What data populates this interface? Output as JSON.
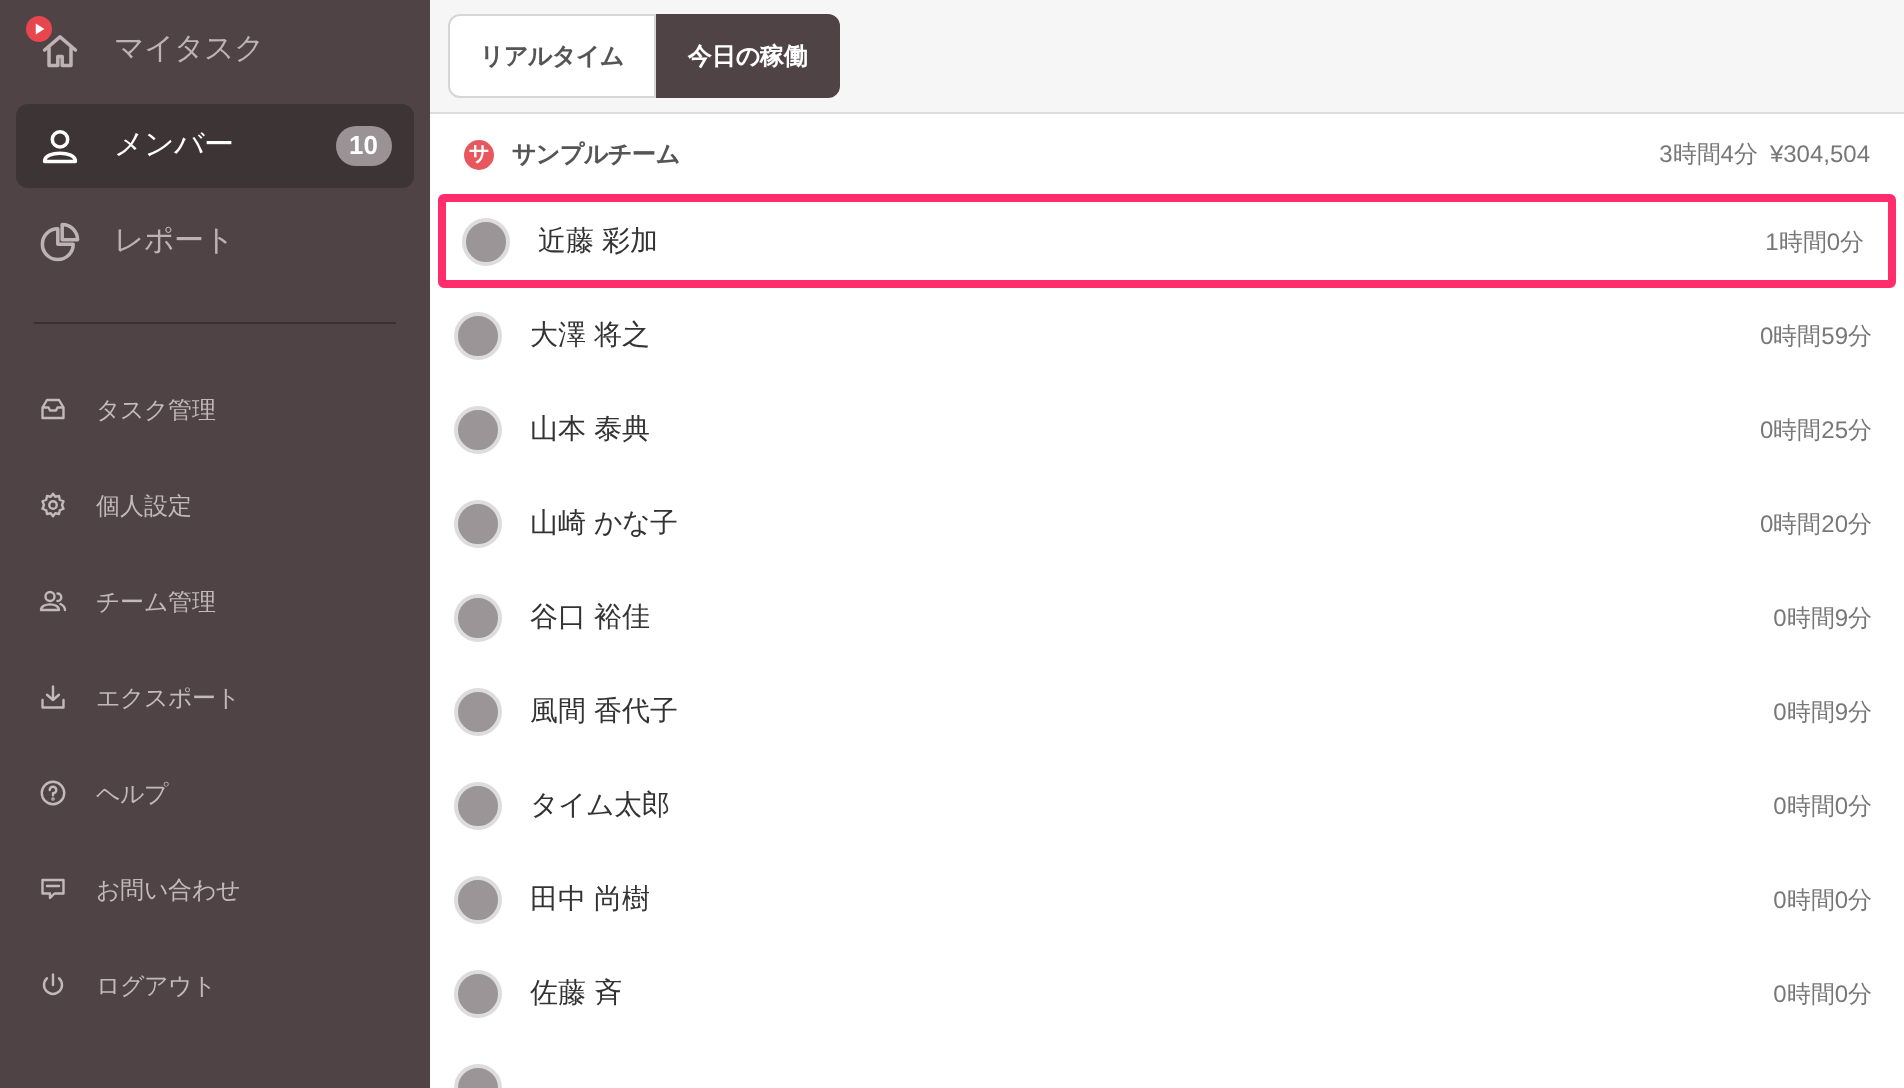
{
  "sidebar": {
    "main_items": [
      {
        "label": "マイタスク",
        "selected": false,
        "notification": true
      },
      {
        "label": "メンバー",
        "selected": true,
        "badge": "10",
        "notification": false
      },
      {
        "label": "レポート",
        "selected": false,
        "notification": false
      }
    ],
    "sub_items": [
      {
        "label": "タスク管理"
      },
      {
        "label": "個人設定"
      },
      {
        "label": "チーム管理"
      },
      {
        "label": "エクスポート"
      },
      {
        "label": "ヘルプ"
      },
      {
        "label": "お問い合わせ"
      },
      {
        "label": "ログアウト"
      }
    ]
  },
  "tabs": [
    {
      "label": "リアルタイム",
      "selected": false
    },
    {
      "label": "今日の稼働",
      "selected": true
    }
  ],
  "team": {
    "initial": "サ",
    "name": "サンプルチーム",
    "time": "3時間4分",
    "amount": "¥304,504"
  },
  "members": [
    {
      "name": "近藤 彩加",
      "time": "1時間0分",
      "highlighted": true
    },
    {
      "name": "大澤 将之",
      "time": "0時間59分",
      "highlighted": false
    },
    {
      "name": "山本 泰典",
      "time": "0時間25分",
      "highlighted": false
    },
    {
      "name": "山崎 かな子",
      "time": "0時間20分",
      "highlighted": false
    },
    {
      "name": "谷口 裕佳",
      "time": "0時間9分",
      "highlighted": false
    },
    {
      "name": "風間 香代子",
      "time": "0時間9分",
      "highlighted": false
    },
    {
      "name": "タイム太郎",
      "time": "0時間0分",
      "highlighted": false
    },
    {
      "name": "田中 尚樹",
      "time": "0時間0分",
      "highlighted": false
    },
    {
      "name": "佐藤 斉",
      "time": "0時間0分",
      "highlighted": false
    }
  ]
}
